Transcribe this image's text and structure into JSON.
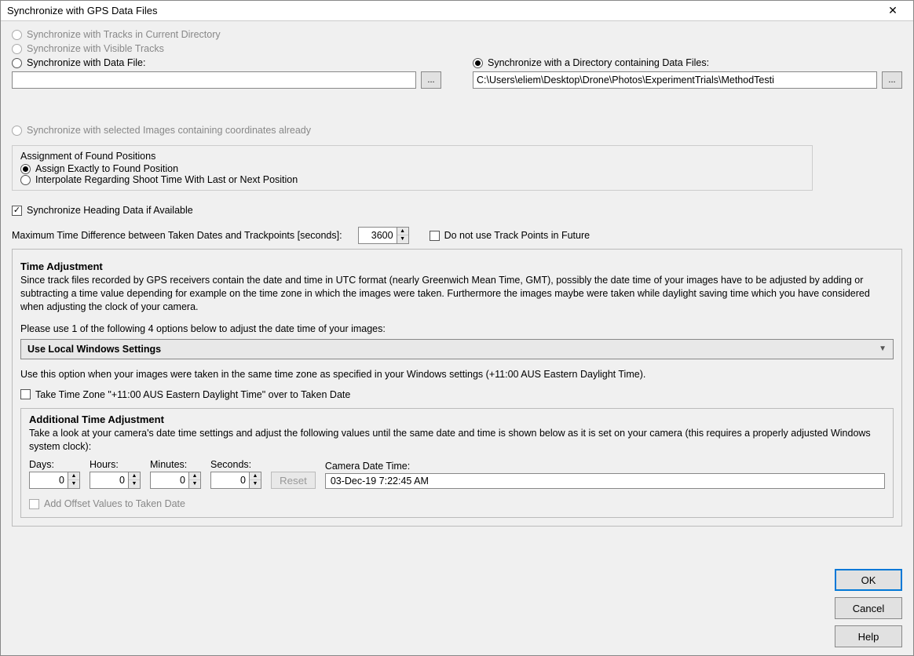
{
  "window": {
    "title": "Synchronize with GPS Data Files"
  },
  "source": {
    "sync_tracks_current_dir": "Synchronize with Tracks in Current Directory",
    "sync_visible_tracks": "Synchronize with Visible Tracks",
    "sync_data_file": "Synchronize with Data File:",
    "data_file_value": "",
    "sync_directory": "Synchronize with a Directory containing Data Files:",
    "directory_value": "C:\\Users\\eliem\\Desktop\\Drone\\Photos\\ExperimentTrials\\MethodTesti",
    "sync_selected_images": "Synchronize with selected Images containing coordinates already"
  },
  "assignment": {
    "heading": "Assignment of Found Positions",
    "exact": "Assign Exactly to Found Position",
    "interpolate": "Interpolate Regarding Shoot Time With Last or Next Position"
  },
  "heading_sync": {
    "label": "Synchronize Heading Data if Available"
  },
  "time_diff": {
    "label": "Maximum Time Difference between Taken Dates and Trackpoints [seconds]:",
    "value": "3600",
    "no_future": "Do not use Track Points in Future"
  },
  "time_adj": {
    "heading": "Time Adjustment",
    "explain": "Since track files recorded by GPS receivers contain the date and time in UTC format (nearly Greenwich Mean Time, GMT), possibly the date time of your images have to be adjusted by adding or subtracting a time value depending for example on the time zone in which the images were taken. Furthermore the images maybe were taken while daylight saving time which you have considered when adjusting the clock of your camera.",
    "instruction": "Please use 1 of the following 4 options below to adjust the date time of your images:",
    "dropdown": "Use Local Windows Settings",
    "hint": "Use this option when your images were taken in the same time zone as specified in your Windows settings (+11:00 AUS Eastern Daylight Time).",
    "take_tz": "Take Time Zone \"+11:00 AUS Eastern Daylight Time\" over to Taken Date"
  },
  "additional": {
    "heading": "Additional Time Adjustment",
    "explain": "Take a look at your camera's date time settings and adjust the following values until the same date and time is shown below as it is  set on your camera (this requires a properly adjusted Windows system clock):",
    "days_label": "Days:",
    "hours_label": "Hours:",
    "minutes_label": "Minutes:",
    "seconds_label": "Seconds:",
    "days": "0",
    "hours": "0",
    "minutes": "0",
    "seconds": "0",
    "reset": "Reset",
    "camera_label": "Camera Date Time:",
    "camera_value": "03-Dec-19 7:22:45 AM",
    "add_offset": "Add Offset Values to Taken Date"
  },
  "buttons": {
    "ok": "OK",
    "cancel": "Cancel",
    "help": "Help"
  }
}
